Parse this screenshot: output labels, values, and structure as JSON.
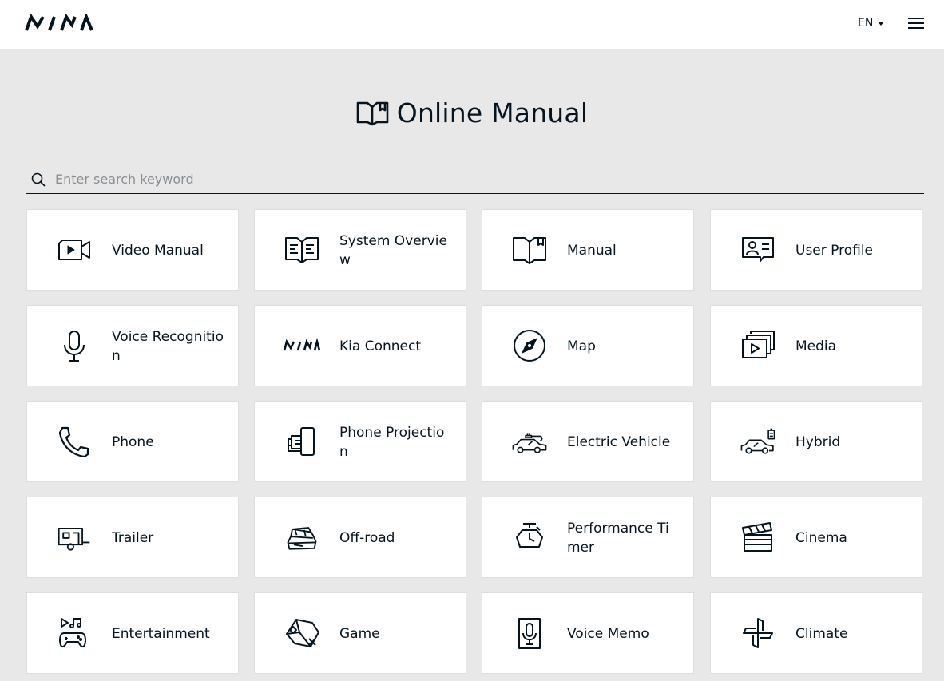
{
  "header": {
    "brand": "KIA",
    "language": "EN",
    "menu_icon": "hamburger-menu-icon"
  },
  "main": {
    "title": "Online Manual",
    "title_icon": "book-icon",
    "search": {
      "placeholder": "Enter search keyword",
      "value": "",
      "icon": "search-icon"
    },
    "tiles": [
      {
        "label": "Video Manual",
        "icon": "video-camera-icon"
      },
      {
        "label": "System Overview",
        "icon": "system-overview-icon"
      },
      {
        "label": "Manual",
        "icon": "book-icon"
      },
      {
        "label": "User Profile",
        "icon": "user-profile-icon"
      },
      {
        "label": "Voice Recognition",
        "icon": "microphone-icon"
      },
      {
        "label": "Kia Connect",
        "icon": "kia-logo-icon"
      },
      {
        "label": "Map",
        "icon": "compass-icon"
      },
      {
        "label": "Media",
        "icon": "media-play-icon"
      },
      {
        "label": "Phone",
        "icon": "phone-icon"
      },
      {
        "label": "Phone Projection",
        "icon": "phone-projection-icon"
      },
      {
        "label": "Electric Vehicle",
        "icon": "electric-vehicle-icon"
      },
      {
        "label": "Hybrid",
        "icon": "hybrid-vehicle-icon"
      },
      {
        "label": "Trailer",
        "icon": "trailer-icon"
      },
      {
        "label": "Off-road",
        "icon": "off-road-icon"
      },
      {
        "label": "Performance Timer",
        "icon": "stopwatch-icon"
      },
      {
        "label": "Cinema",
        "icon": "clapperboard-icon"
      },
      {
        "label": "Entertainment",
        "icon": "entertainment-icon"
      },
      {
        "label": "Game",
        "icon": "game-icon"
      },
      {
        "label": "Voice Memo",
        "icon": "voice-memo-icon"
      },
      {
        "label": "Climate",
        "icon": "climate-fan-icon"
      }
    ]
  },
  "colors": {
    "background": "#e8e8e8",
    "card": "#ffffff",
    "text": "#05141f",
    "placeholder": "#8a8f94"
  }
}
